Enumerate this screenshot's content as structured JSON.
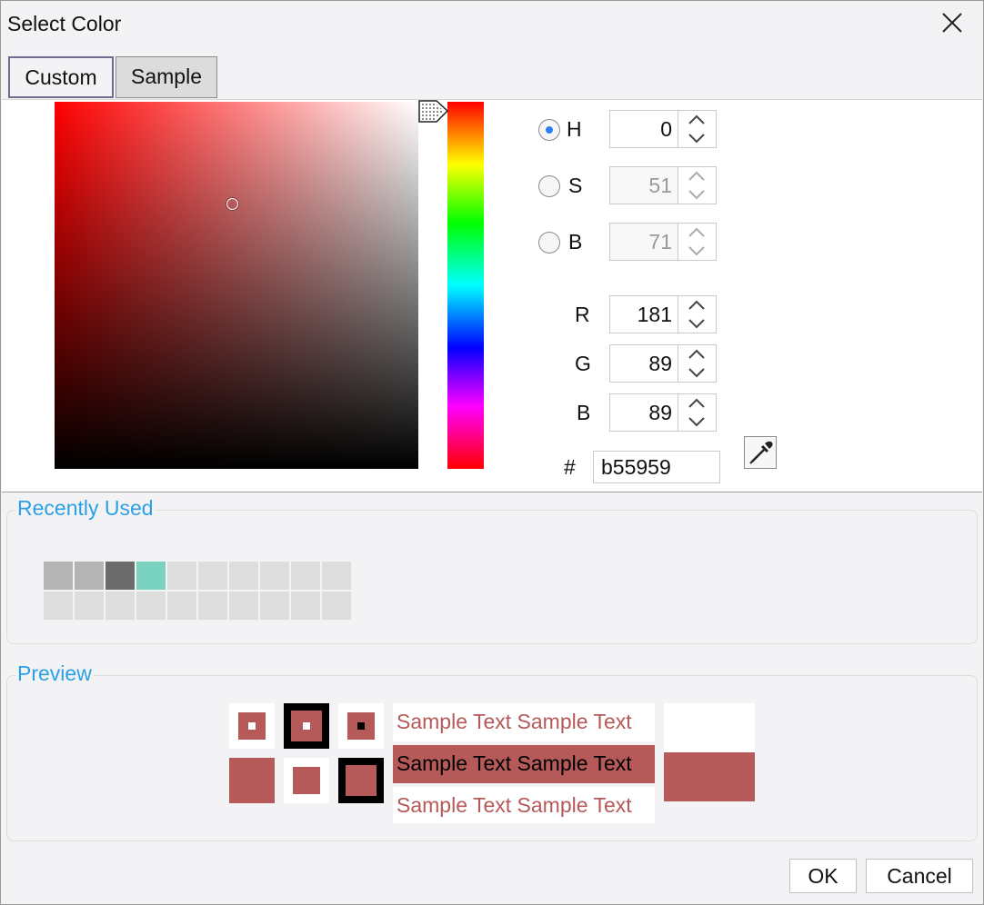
{
  "window": {
    "title": "Select Color"
  },
  "tabs": [
    {
      "label": "Custom"
    },
    {
      "label": "Sample"
    }
  ],
  "fields": {
    "h": {
      "label": "H",
      "value": "0"
    },
    "s": {
      "label": "S",
      "value": "51"
    },
    "b_hsb": {
      "label": "B",
      "value": "71"
    },
    "r": {
      "label": "R",
      "value": "181"
    },
    "g": {
      "label": "G",
      "value": "89"
    },
    "b_rgb": {
      "label": "B",
      "value": "89"
    },
    "hex": {
      "label": "#",
      "value": "b55959"
    }
  },
  "recently_used": {
    "title": "Recently Used",
    "colors": [
      "#b4b4b4",
      "#b4b4b4",
      "#6b6b6b",
      "#78d2be",
      "#dddddd",
      "#dddddd",
      "#dddddd",
      "#dddddd",
      "#dddddd",
      "#dddddd",
      "#dddddd",
      "#dddddd",
      "#dddddd",
      "#dddddd",
      "#dddddd",
      "#dddddd",
      "#dddddd",
      "#dddddd",
      "#dddddd",
      "#dddddd"
    ]
  },
  "preview": {
    "title": "Preview",
    "sample_text": "Sample Text Sample Text",
    "color": "#b55959"
  },
  "buttons": {
    "ok": "OK",
    "cancel": "Cancel"
  }
}
